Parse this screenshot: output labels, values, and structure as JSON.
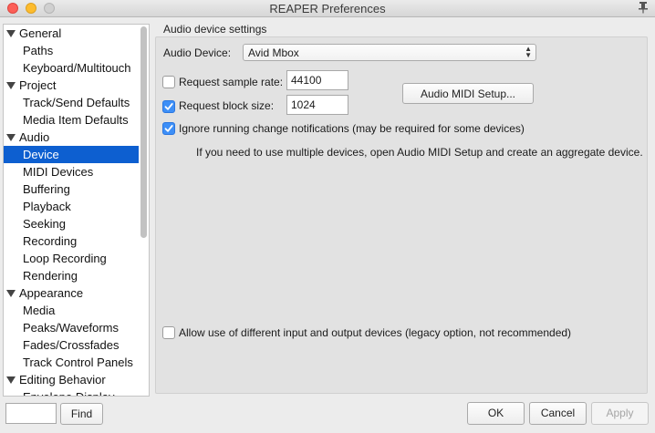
{
  "window": {
    "title": "REAPER Preferences"
  },
  "tree": [
    {
      "label": "General",
      "type": "cat",
      "name": "tree-cat-general"
    },
    {
      "label": "Paths",
      "type": "child",
      "name": "tree-item-paths"
    },
    {
      "label": "Keyboard/Multitouch",
      "type": "child",
      "name": "tree-item-keyboard-multitouch"
    },
    {
      "label": "Project",
      "type": "cat",
      "name": "tree-cat-project"
    },
    {
      "label": "Track/Send Defaults",
      "type": "child",
      "name": "tree-item-track-send-defaults"
    },
    {
      "label": "Media Item Defaults",
      "type": "child",
      "name": "tree-item-media-item-defaults"
    },
    {
      "label": "Audio",
      "type": "cat",
      "name": "tree-cat-audio"
    },
    {
      "label": "Device",
      "type": "child",
      "selected": true,
      "name": "tree-item-device"
    },
    {
      "label": "MIDI Devices",
      "type": "child",
      "name": "tree-item-midi-devices"
    },
    {
      "label": "Buffering",
      "type": "child",
      "name": "tree-item-buffering"
    },
    {
      "label": "Playback",
      "type": "child",
      "name": "tree-item-playback"
    },
    {
      "label": "Seeking",
      "type": "child",
      "name": "tree-item-seeking"
    },
    {
      "label": "Recording",
      "type": "child",
      "name": "tree-item-recording"
    },
    {
      "label": "Loop Recording",
      "type": "child",
      "name": "tree-item-loop-recording"
    },
    {
      "label": "Rendering",
      "type": "child",
      "name": "tree-item-rendering"
    },
    {
      "label": "Appearance",
      "type": "cat",
      "name": "tree-cat-appearance"
    },
    {
      "label": "Media",
      "type": "child",
      "name": "tree-item-media"
    },
    {
      "label": "Peaks/Waveforms",
      "type": "child",
      "name": "tree-item-peaks-waveforms"
    },
    {
      "label": "Fades/Crossfades",
      "type": "child",
      "name": "tree-item-fades-crossfades"
    },
    {
      "label": "Track Control Panels",
      "type": "child",
      "name": "tree-item-track-control-panels"
    },
    {
      "label": "Editing Behavior",
      "type": "cat",
      "name": "tree-cat-editing-behavior"
    },
    {
      "label": "Envelope Display",
      "type": "child",
      "name": "tree-item-envelope-display"
    }
  ],
  "search": {
    "value": "",
    "find_label": "Find"
  },
  "audio": {
    "section_title": "Audio device settings",
    "device_label": "Audio Device:",
    "device_value": "Avid Mbox",
    "sample_rate_label": "Request sample rate:",
    "sample_rate_value": "44100",
    "sample_rate_checked": false,
    "block_size_label": "Request block size:",
    "block_size_value": "1024",
    "block_size_checked": true,
    "midi_setup_label": "Audio MIDI Setup...",
    "ignore_label": "Ignore running change notifications (may be required for some devices)",
    "ignore_checked": true,
    "info_text": "If you need to use multiple devices, open Audio MIDI Setup and create an aggregate device.",
    "legacy_label": "Allow use of different input and output devices (legacy option, not recommended)",
    "legacy_checked": false
  },
  "buttons": {
    "ok": "OK",
    "cancel": "Cancel",
    "apply": "Apply"
  },
  "colors": {
    "selection": "#0d5fd0",
    "checkbox_checked": "#3d8ff7"
  }
}
